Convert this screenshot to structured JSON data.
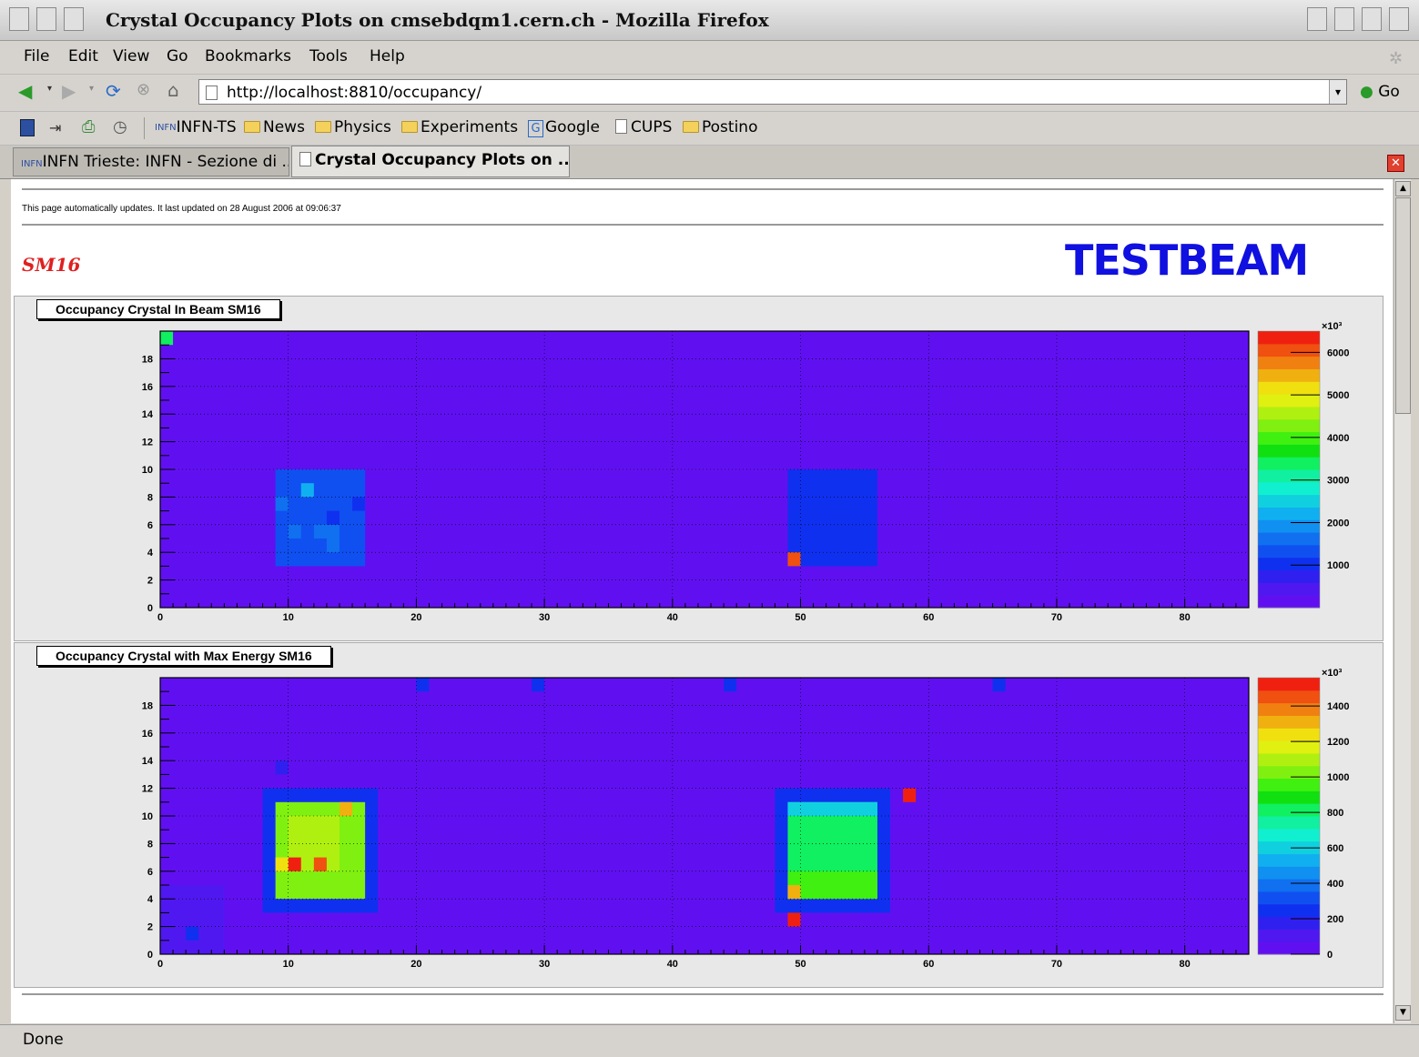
{
  "window": {
    "title": "Crystal Occupancy Plots on cmsebdqm1.cern.ch - Mozilla Firefox"
  },
  "menu": {
    "items": [
      "File",
      "Edit",
      "View",
      "Go",
      "Bookmarks",
      "Tools",
      "Help"
    ]
  },
  "nav": {
    "url": "http://localhost:8810/occupancy/",
    "go_label": "Go"
  },
  "bookmarks": {
    "items": [
      {
        "label": "INFN-TS",
        "icon": "infn-icon"
      },
      {
        "label": "News",
        "icon": "folder-icon"
      },
      {
        "label": "Physics",
        "icon": "folder-icon"
      },
      {
        "label": "Experiments",
        "icon": "folder-icon"
      },
      {
        "label": "Google",
        "icon": "google-icon"
      },
      {
        "label": "CUPS",
        "icon": "page-icon"
      },
      {
        "label": "Postino",
        "icon": "folder-icon"
      }
    ]
  },
  "tabs": [
    {
      "label": "INFN Trieste: INFN - Sezione di ...",
      "active": false
    },
    {
      "label": "Crystal Occupancy Plots on ...",
      "active": true
    }
  ],
  "page": {
    "update_text": "This page automatically updates. It last updated on 28 August 2006 at 09:06:37",
    "sm_label": "SM16",
    "testbeam_label": "TESTBEAM"
  },
  "status": {
    "text": "Done"
  },
  "colors": {
    "accent_red": "#e02020",
    "testbeam_blue": "#1010e0",
    "plot_background": "#6010f0"
  },
  "chart_data": [
    {
      "type": "heatmap",
      "title": "Occupancy Crystal In Beam SM16",
      "xlim": [
        0,
        85
      ],
      "ylim": [
        0,
        20
      ],
      "x_ticks": [
        0,
        10,
        20,
        30,
        40,
        50,
        60,
        70,
        80
      ],
      "y_ticks": [
        0,
        2,
        4,
        6,
        8,
        10,
        12,
        14,
        16,
        18
      ],
      "colorbar_ticks": [
        1000,
        2000,
        3000,
        4000,
        5000,
        6000
      ],
      "colorbar_exponent": "×10³",
      "zmax": 6500,
      "regions": [
        {
          "x0": 0,
          "x1": 1,
          "y0": 19,
          "y1": 20,
          "value": 3500
        },
        {
          "x0": 9,
          "x1": 16,
          "y0": 3,
          "y1": 10,
          "value": 1300
        },
        {
          "x0": 11,
          "x1": 12,
          "y0": 8,
          "y1": 9,
          "value": 2100
        },
        {
          "x0": 9,
          "x1": 10,
          "y0": 7,
          "y1": 8,
          "value": 1700
        },
        {
          "x0": 10,
          "x1": 11,
          "y0": 5,
          "y1": 6,
          "value": 1600
        },
        {
          "x0": 12,
          "x1": 14,
          "y0": 5,
          "y1": 6,
          "value": 1600
        },
        {
          "x0": 13,
          "x1": 14,
          "y0": 4,
          "y1": 5,
          "value": 1700
        },
        {
          "x0": 13,
          "x1": 14,
          "y0": 6,
          "y1": 7,
          "value": 900
        },
        {
          "x0": 15,
          "x1": 16,
          "y0": 7,
          "y1": 8,
          "value": 900
        },
        {
          "x0": 49,
          "x1": 56,
          "y0": 3,
          "y1": 10,
          "value": 900
        },
        {
          "x0": 49,
          "x1": 56,
          "y0": 3,
          "y1": 5,
          "value": 1100
        },
        {
          "x0": 49,
          "x1": 50,
          "y0": 3,
          "y1": 4,
          "value": 6200
        }
      ]
    },
    {
      "type": "heatmap",
      "title": "Occupancy Crystal with Max Energy SM16",
      "xlim": [
        0,
        85
      ],
      "ylim": [
        0,
        20
      ],
      "x_ticks": [
        0,
        10,
        20,
        30,
        40,
        50,
        60,
        70,
        80
      ],
      "y_ticks": [
        0,
        2,
        4,
        6,
        8,
        10,
        12,
        14,
        16,
        18
      ],
      "colorbar_ticks": [
        0,
        200,
        400,
        600,
        800,
        1000,
        1200,
        1400
      ],
      "colorbar_exponent": "×10³",
      "zmax": 1560,
      "regions": [
        {
          "x0": 0,
          "x1": 5,
          "y0": 0,
          "y1": 5,
          "value": 120
        },
        {
          "x0": 2,
          "x1": 3,
          "y0": 1,
          "y1": 2,
          "value": 220
        },
        {
          "x0": 9,
          "x1": 10,
          "y0": 13,
          "y1": 14,
          "value": 200
        },
        {
          "x0": 20,
          "x1": 21,
          "y0": 19,
          "y1": 20,
          "value": 220
        },
        {
          "x0": 29,
          "x1": 30,
          "y0": 19,
          "y1": 20,
          "value": 220
        },
        {
          "x0": 44,
          "x1": 45,
          "y0": 19,
          "y1": 20,
          "value": 220
        },
        {
          "x0": 65,
          "x1": 66,
          "y0": 19,
          "y1": 20,
          "value": 220
        },
        {
          "x0": 8,
          "x1": 17,
          "y0": 3,
          "y1": 12,
          "value": 220
        },
        {
          "x0": 9,
          "x1": 16,
          "y0": 4,
          "y1": 11,
          "value": 1000
        },
        {
          "x0": 10,
          "x1": 14,
          "y0": 6,
          "y1": 10,
          "value": 1100
        },
        {
          "x0": 10,
          "x1": 11,
          "y0": 6,
          "y1": 7,
          "value": 1500
        },
        {
          "x0": 12,
          "x1": 13,
          "y0": 6,
          "y1": 7,
          "value": 1450
        },
        {
          "x0": 14,
          "x1": 15,
          "y0": 10,
          "y1": 11,
          "value": 1300
        },
        {
          "x0": 9,
          "x1": 10,
          "y0": 6,
          "y1": 7,
          "value": 1250
        },
        {
          "x0": 48,
          "x1": 57,
          "y0": 3,
          "y1": 12,
          "value": 220
        },
        {
          "x0": 49,
          "x1": 56,
          "y0": 4,
          "y1": 11,
          "value": 800
        },
        {
          "x0": 49,
          "x1": 56,
          "y0": 10,
          "y1": 11,
          "value": 600
        },
        {
          "x0": 49,
          "x1": 56,
          "y0": 4,
          "y1": 6,
          "value": 950
        },
        {
          "x0": 49,
          "x1": 50,
          "y0": 4,
          "y1": 5,
          "value": 1300
        },
        {
          "x0": 49,
          "x1": 50,
          "y0": 2,
          "y1": 3,
          "value": 1600
        },
        {
          "x0": 58,
          "x1": 59,
          "y0": 11,
          "y1": 12,
          "value": 1600
        }
      ]
    }
  ]
}
